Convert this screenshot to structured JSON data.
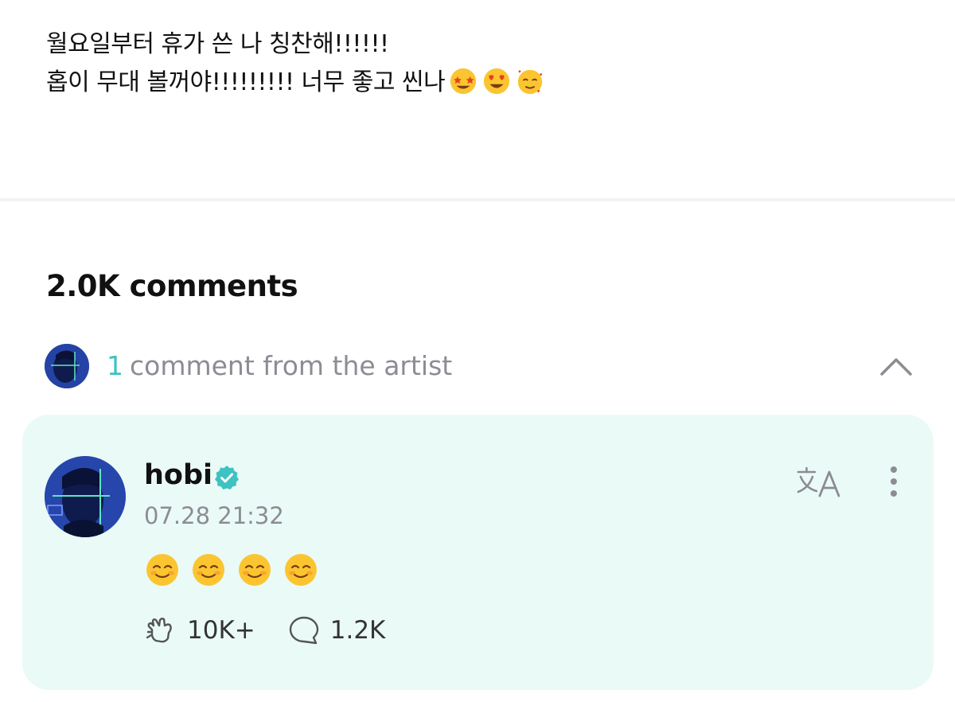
{
  "post": {
    "line1": "월요일부터 휴가 쓴 나 칭찬해!!!!!!",
    "line2": "홉이 무대 볼꺼야!!!!!!!!! 너무 좋고 씬나",
    "line2_emojis": [
      "star-struck-emoji",
      "heart-eyes-emoji",
      "smiling-face-with-hearts-emoji"
    ]
  },
  "comments": {
    "count_label": "2.0K comments"
  },
  "artist_section": {
    "count": "1",
    "label": "comment from the artist",
    "collapse_icon": "chevron-up-icon"
  },
  "artist_comment": {
    "author": "hobi",
    "verified_icon": "verified-badge-icon",
    "timestamp": "07.28 21:32",
    "content_emojis": [
      "smiling-face-emoji",
      "smiling-face-emoji",
      "smiling-face-emoji",
      "smiling-face-emoji"
    ],
    "likes": "10K+",
    "replies": "1.2K",
    "translate_icon": "translate-icon",
    "more_icon": "more-vertical-icon"
  },
  "colors": {
    "accent": "#3ec2c2",
    "card_background": "#eafaf7",
    "muted_text": "#8c8c94"
  }
}
